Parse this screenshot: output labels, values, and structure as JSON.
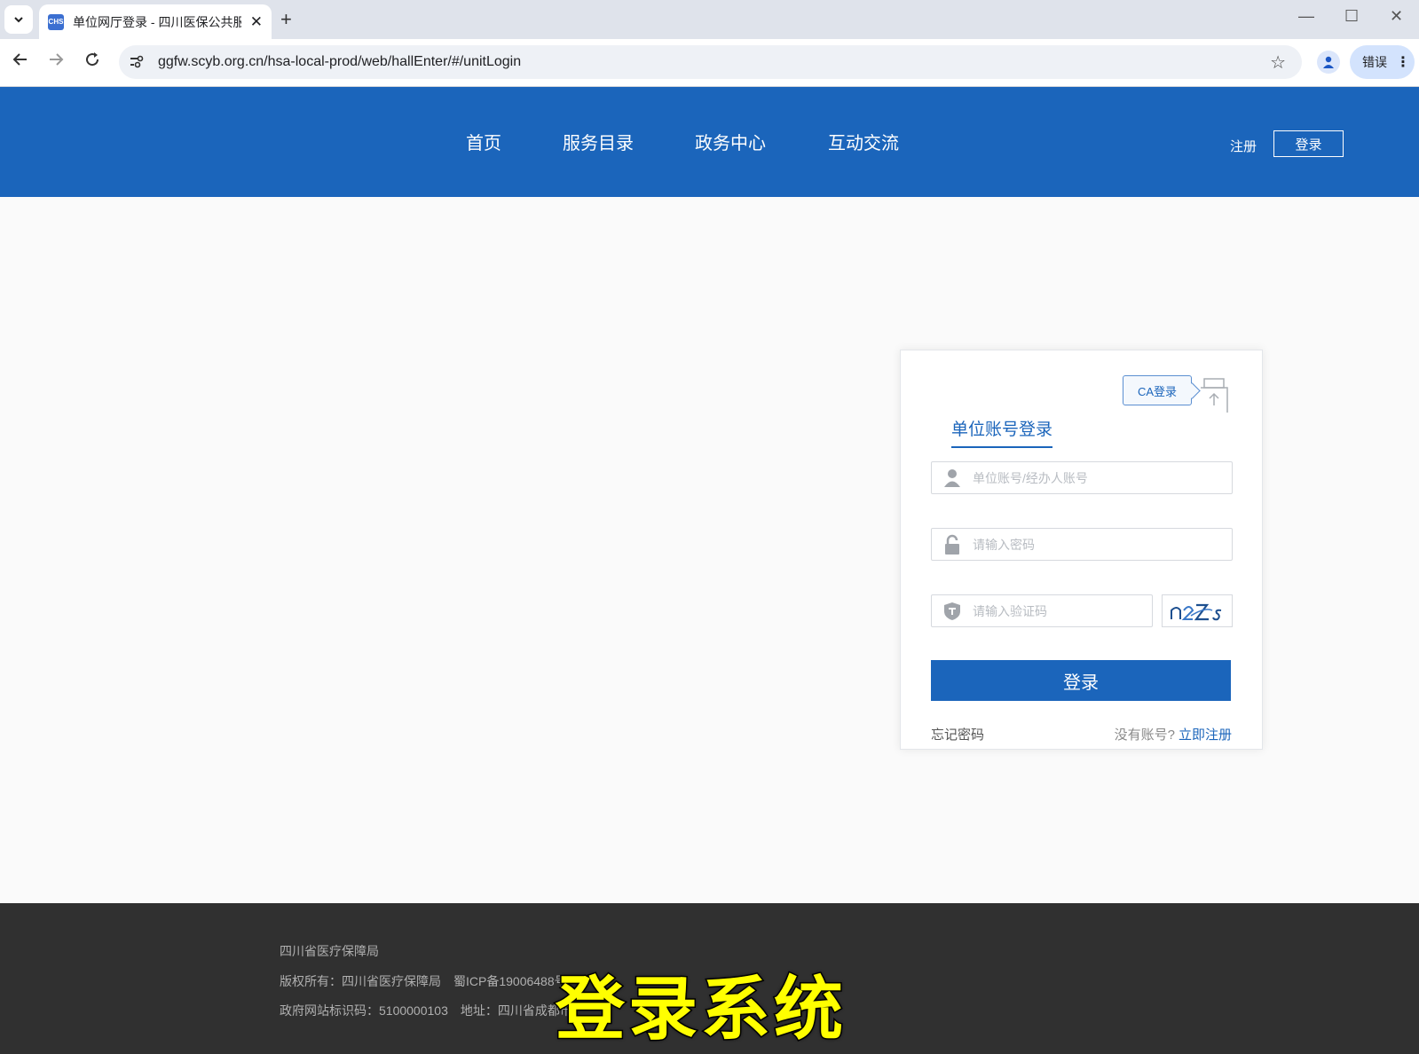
{
  "browser": {
    "tab_title": "单位网厅登录 - 四川医保公共服",
    "tab_favicon_text": "CHS",
    "url": "ggfw.scyb.org.cn/hsa-local-prod/web/hallEnter/#/unitLogin",
    "error_label": "错误"
  },
  "header": {
    "nav": [
      "首页",
      "服务目录",
      "政务中心",
      "互动交流"
    ],
    "register_label": "注册",
    "login_label": "登录"
  },
  "login_card": {
    "ca_label": "CA登录",
    "tab_label": "单位账号登录",
    "account_placeholder": "单位账号/经办人账号",
    "password_placeholder": "请输入密码",
    "captcha_placeholder": "请输入验证码",
    "captcha_text": "n2Zs",
    "submit_label": "登录",
    "forgot_label": "忘记密码",
    "no_account_label": "没有账号?",
    "register_now_label": "立即注册"
  },
  "footer": {
    "line1": "四川省医疗保障局",
    "line2": "版权所有：四川省医疗保障局　蜀ICP备19006488号",
    "line3": "政府网站标识码：5100000103　地址：四川省成都市"
  },
  "overlay_caption": "登录系统",
  "colors": {
    "brand_blue": "#1b65bb",
    "footer_bg": "#303030",
    "caption_yellow": "#ffff00"
  }
}
